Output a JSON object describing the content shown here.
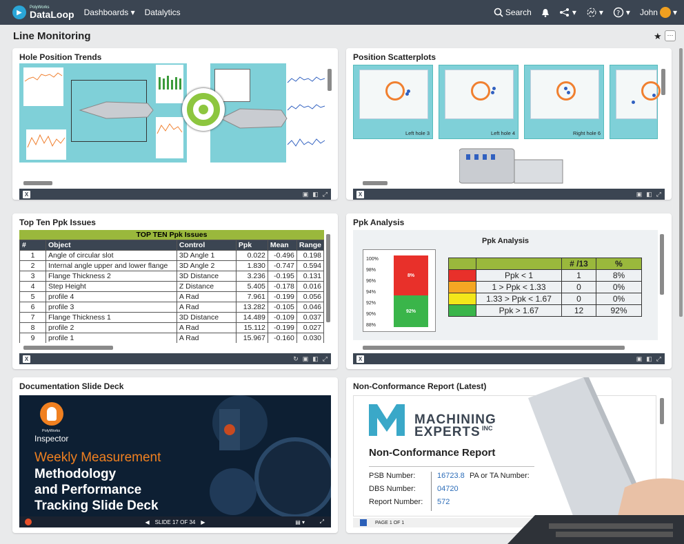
{
  "app": {
    "logo_small": "PolyWorks",
    "logo_big": "DataLoop",
    "nav": {
      "dashboards": "Dashboards ▾",
      "datalytics": "Datalytics"
    },
    "search_label": "Search",
    "user_name": "John"
  },
  "page": {
    "title": "Line Monitoring"
  },
  "cards": {
    "hole_trends": {
      "title": "Hole Position Trends"
    },
    "scatterplots": {
      "title": "Position Scatterplots",
      "labels": [
        "Left hole 3",
        "Left hole 4",
        "Right hole 6"
      ]
    },
    "top_ten": {
      "title": "Top Ten Ppk Issues",
      "table_title": "TOP TEN Ppk Issues",
      "columns": [
        "#",
        "Object",
        "Control",
        "Ppk",
        "Mean",
        "Range"
      ],
      "rows": [
        [
          "1",
          "Angle of circular slot",
          "3D Angle 1",
          "0.022",
          "-0.496",
          "0.198"
        ],
        [
          "2",
          "Internal angle upper and lower flange",
          "3D Angle 2",
          "1.830",
          "-0.747",
          "0.594"
        ],
        [
          "3",
          "Flange Thickness 2",
          "3D Distance",
          "3.236",
          "-0.195",
          "0.131"
        ],
        [
          "4",
          "Step Height",
          "Z Distance",
          "5.405",
          "-0.178",
          "0.016"
        ],
        [
          "5",
          "profile 4",
          "A Rad",
          "7.961",
          "-0.199",
          "0.056"
        ],
        [
          "6",
          "profile 3",
          "A Rad",
          "13.282",
          "-0.105",
          "0.046"
        ],
        [
          "7",
          "Flange Thickness 1",
          "3D Distance",
          "14.489",
          "-0.109",
          "0.037"
        ],
        [
          "8",
          "profile 2",
          "A Rad",
          "15.112",
          "-0.199",
          "0.027"
        ],
        [
          "9",
          "profile 1",
          "A Rad",
          "15.967",
          "-0.160",
          "0.030"
        ]
      ]
    },
    "ppk_analysis": {
      "title": "Ppk Analysis",
      "chart_title": "Ppk Analysis",
      "axis_ticks": [
        "100%",
        "98%",
        "96%",
        "94%",
        "92%",
        "90%",
        "88%"
      ],
      "bar_labels": {
        "red": "8%",
        "green": "92%"
      },
      "summary_headers": [
        "",
        "",
        "# /13",
        "%"
      ],
      "summary_rows": [
        {
          "color": "#e8302a",
          "label": "Ppk < 1",
          "count": "1",
          "pct": "8%"
        },
        {
          "color": "#f5a623",
          "label": "1 > Ppk < 1.33",
          "count": "0",
          "pct": "0%"
        },
        {
          "color": "#f3e61a",
          "label": "1.33 > Ppk < 1.67",
          "count": "0",
          "pct": "0%"
        },
        {
          "color": "#3ab54a",
          "label": "Ppk > 1.67",
          "count": "12",
          "pct": "92%"
        }
      ]
    },
    "slide_deck": {
      "title": "Documentation Slide Deck",
      "brand_small": "PolyWorks",
      "brand": "Inspector",
      "heading_orange": "Weekly Measurement",
      "heading_white_1": "Methodology",
      "heading_white_2": "and Performance",
      "heading_white_3": "Tracking Slide Deck",
      "slide_counter": "SLIDE 17 OF 34"
    },
    "ncr": {
      "title": "Non-Conformance Report (Latest)",
      "company_1": "MACHINING",
      "company_2": "EXPERTS",
      "company_inc": "INC",
      "report_title": "Non-Conformance Report",
      "fields": [
        {
          "label": "PSB Number:",
          "value": "16723.8"
        },
        {
          "label": "DBS Number:",
          "value": "04720"
        },
        {
          "label": "Report Number:",
          "value": "572"
        }
      ],
      "extra_label": "PA or TA Number:",
      "page_label": "PAGE 1 OF 1"
    }
  }
}
